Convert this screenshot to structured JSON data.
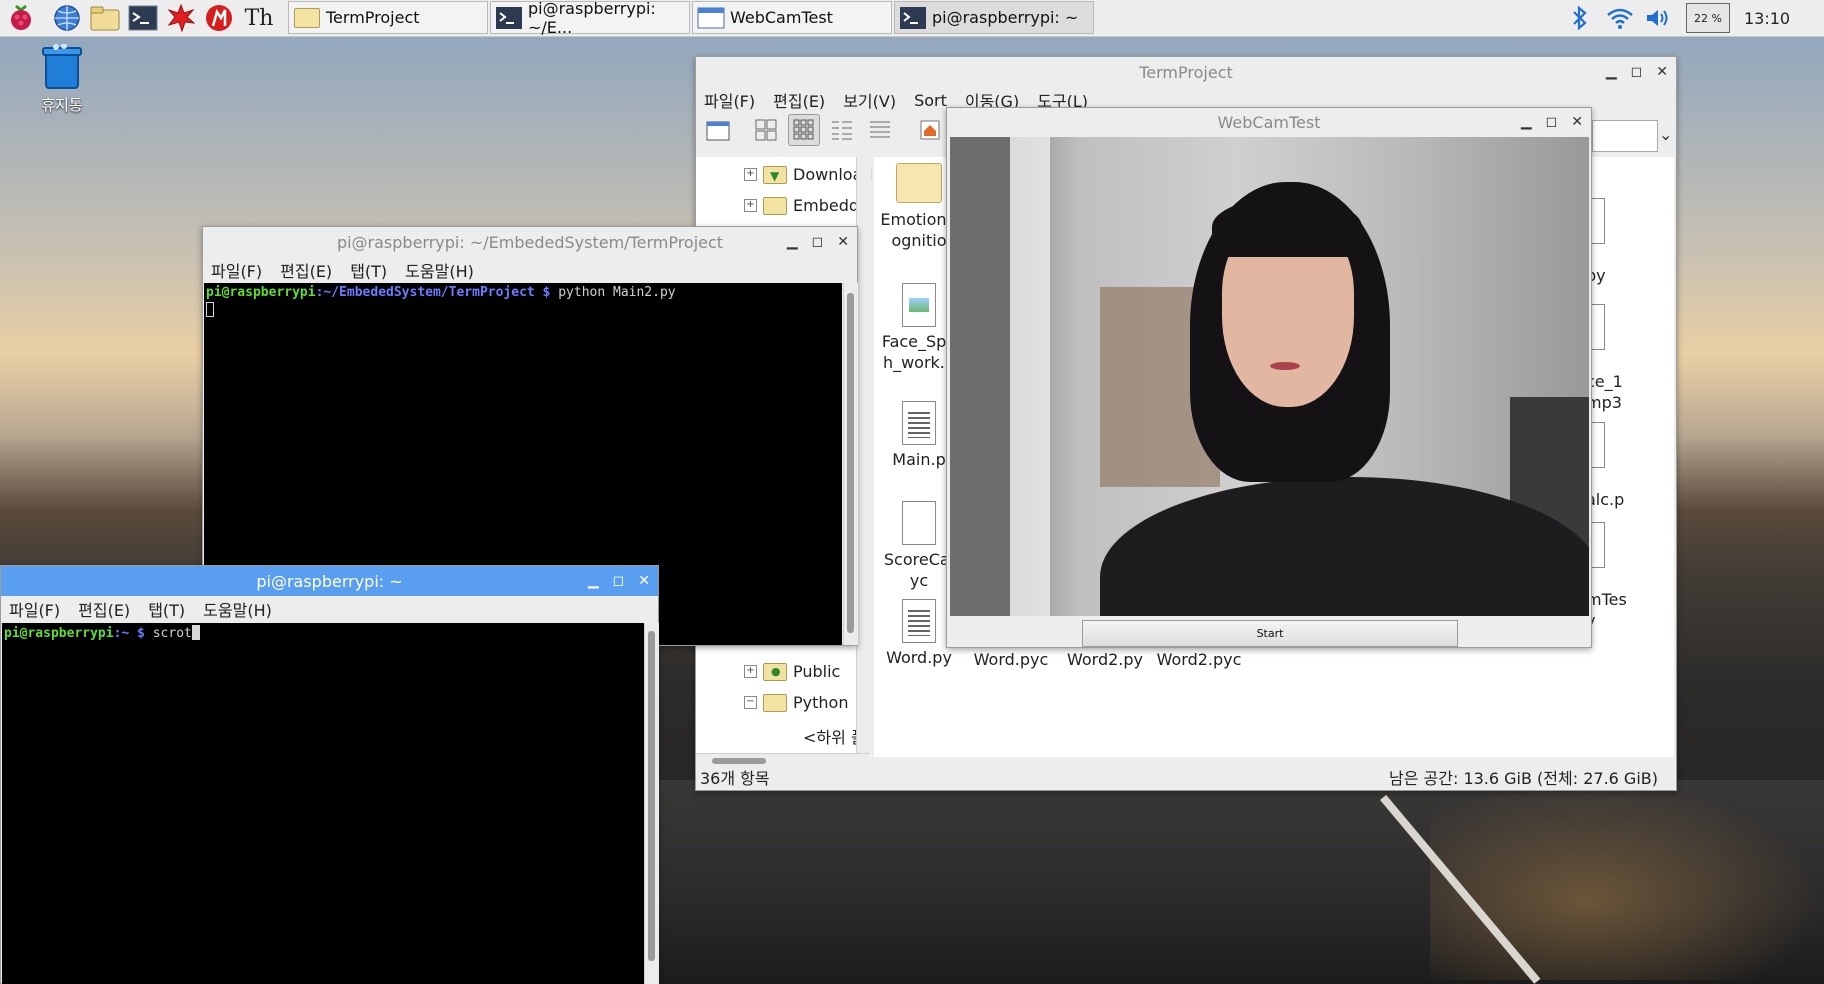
{
  "taskbar": {
    "launchers": [
      "raspberry-menu-icon",
      "web-browser-icon",
      "file-manager-icon",
      "terminal-icon",
      "mathematica-icon",
      "wolfram-icon",
      "thonny-icon"
    ],
    "tasks": [
      {
        "label": "TermProject"
      },
      {
        "label": "pi@raspberrypi: ~/E..."
      },
      {
        "label": "WebCamTest"
      },
      {
        "label": "pi@raspberrypi: ~"
      }
    ],
    "cpu": "22 %",
    "clock": "13:10"
  },
  "desktop": {
    "trash_label": "휴지통"
  },
  "file_manager": {
    "title": "TermProject",
    "menu": [
      "파일(F)",
      "편집(E)",
      "보기(V)",
      "Sort",
      "이동(G)",
      "도구(L)"
    ],
    "tree": [
      {
        "label": "Download",
        "exp": "+"
      },
      {
        "label": "Embedde",
        "exp": "+"
      },
      {
        "label": "Public",
        "exp": "+"
      },
      {
        "label": "Python",
        "exp": "−"
      },
      {
        "label": "<하위 폴"
      }
    ],
    "files_col1": [
      "EmotionR\nognitio",
      "Face_Spe\nh_work.p",
      "Main.p",
      "ScoreCal\nyc",
      "Word.py"
    ],
    "files_right": [
      "py",
      "ce_1\nmp3",
      "alc.p",
      "mTes\ny"
    ],
    "files_bottom": [
      "Word.pyc",
      "Word2.py",
      "Word2.pyc"
    ],
    "status_left": "36개 항목",
    "status_right": "남은 공간: 13.6 GiB (전체: 27.6 GiB)"
  },
  "terminal1": {
    "title": "pi@raspberrypi: ~/EmbededSystem/TermProject",
    "menu": [
      "파일(F)",
      "편집(E)",
      "탭(T)",
      "도움말(H)"
    ],
    "prompt_user": "pi@raspberrypi",
    "prompt_path": ":~/EmbededSystem/TermProject $",
    "command": " python Main2.py"
  },
  "terminal2": {
    "title": "pi@raspberrypi: ~",
    "menu": [
      "파일(F)",
      "편집(E)",
      "탭(T)",
      "도움말(H)"
    ],
    "prompt_user": "pi@raspberrypi",
    "prompt_path": ":~ $",
    "command": " scrot"
  },
  "webcam": {
    "title": "WebCamTest",
    "start_label": "Start"
  },
  "colors": {
    "active_title": "#5a9ef0",
    "prompt_green": "#5fdc2e",
    "prompt_blue": "#6a7cff"
  }
}
